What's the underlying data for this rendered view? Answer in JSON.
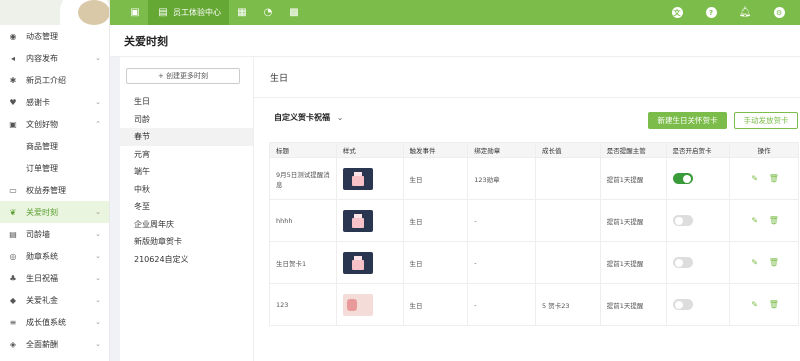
{
  "sidebar": {
    "items": [
      {
        "label": "动态管理",
        "icon": "dynamic-icon"
      },
      {
        "label": "内容发布",
        "icon": "send-icon",
        "chevron": "⌄"
      },
      {
        "label": "新员工介绍",
        "icon": "bulb-icon"
      },
      {
        "label": "感谢卡",
        "icon": "heart-icon",
        "chevron": "⌄"
      },
      {
        "label": "文创好物",
        "icon": "gift-box-icon",
        "chevron": "⌃"
      },
      {
        "label": "商品管理",
        "sub": true
      },
      {
        "label": "订单管理",
        "sub": true
      },
      {
        "label": "权益券管理",
        "icon": "coupon-icon"
      },
      {
        "label": "关爱时刻",
        "icon": "care-icon",
        "chevron": "⌄",
        "active": true
      },
      {
        "label": "司龄墙",
        "icon": "wall-icon",
        "chevron": "⌄"
      },
      {
        "label": "勋章系统",
        "icon": "medal-icon",
        "chevron": "⌄"
      },
      {
        "label": "生日祝福",
        "icon": "cake-icon",
        "chevron": "⌄"
      },
      {
        "label": "关爱礼金",
        "icon": "money-icon",
        "chevron": "⌄"
      },
      {
        "label": "成长值系统",
        "icon": "stack-icon",
        "chevron": "⌄"
      },
      {
        "label": "全面薪酬",
        "icon": "salary-icon",
        "chevron": "⌄"
      }
    ]
  },
  "topbar": {
    "active_tab": "员工体验中心",
    "colors": {
      "bar": "#7cbc4a",
      "active": "#65a834"
    },
    "icons": [
      "briefcase-icon",
      "book-icon",
      "grid-icon",
      "chart-pie-icon",
      "apps-icon"
    ],
    "right_icons": [
      "translate-icon",
      "help-icon",
      "bell-icon",
      "settings-icon"
    ]
  },
  "page": {
    "title": "关爱时刻"
  },
  "moments": {
    "create_label": "+ 创建更多时刻",
    "items": [
      "生日",
      "司龄",
      "春节",
      "元宵",
      "端午",
      "中秋",
      "冬至",
      "企业周年庆",
      "新版勋章贺卡",
      "210624自定义"
    ],
    "selected": "春节"
  },
  "detail": {
    "title": "生日",
    "dropdown_label": "自定义贺卡祝福",
    "dropdown_icon": "⌄",
    "new_button": "新建生日关怀贺卡",
    "manual_button": "手动发放贺卡"
  },
  "table": {
    "headers": [
      "标题",
      "样式",
      "触发事件",
      "绑定勋章",
      "成长值",
      "是否提醒主管",
      "是否开启贺卡",
      "操作"
    ],
    "rows": [
      {
        "title": "9月5日测试提醒消息",
        "thumb": "dark",
        "event": "生日",
        "medal": "123勋章",
        "growth": "",
        "remind": "提前1天提醒",
        "enabled": true
      },
      {
        "title": "hhhh",
        "thumb": "dark",
        "event": "生日",
        "medal": "-",
        "growth": "",
        "remind": "提前1天提醒",
        "enabled": false
      },
      {
        "title": "生日贺卡1",
        "thumb": "dark",
        "event": "生日",
        "medal": "-",
        "growth": "",
        "remind": "提前1天提醒",
        "enabled": false
      },
      {
        "title": "123",
        "thumb": "pink",
        "event": "生日",
        "medal": "-",
        "growth": "5 贺卡23",
        "remind": "提前1天提醒",
        "enabled": false
      }
    ],
    "action_icons": [
      "edit-icon",
      "delete-icon"
    ]
  }
}
